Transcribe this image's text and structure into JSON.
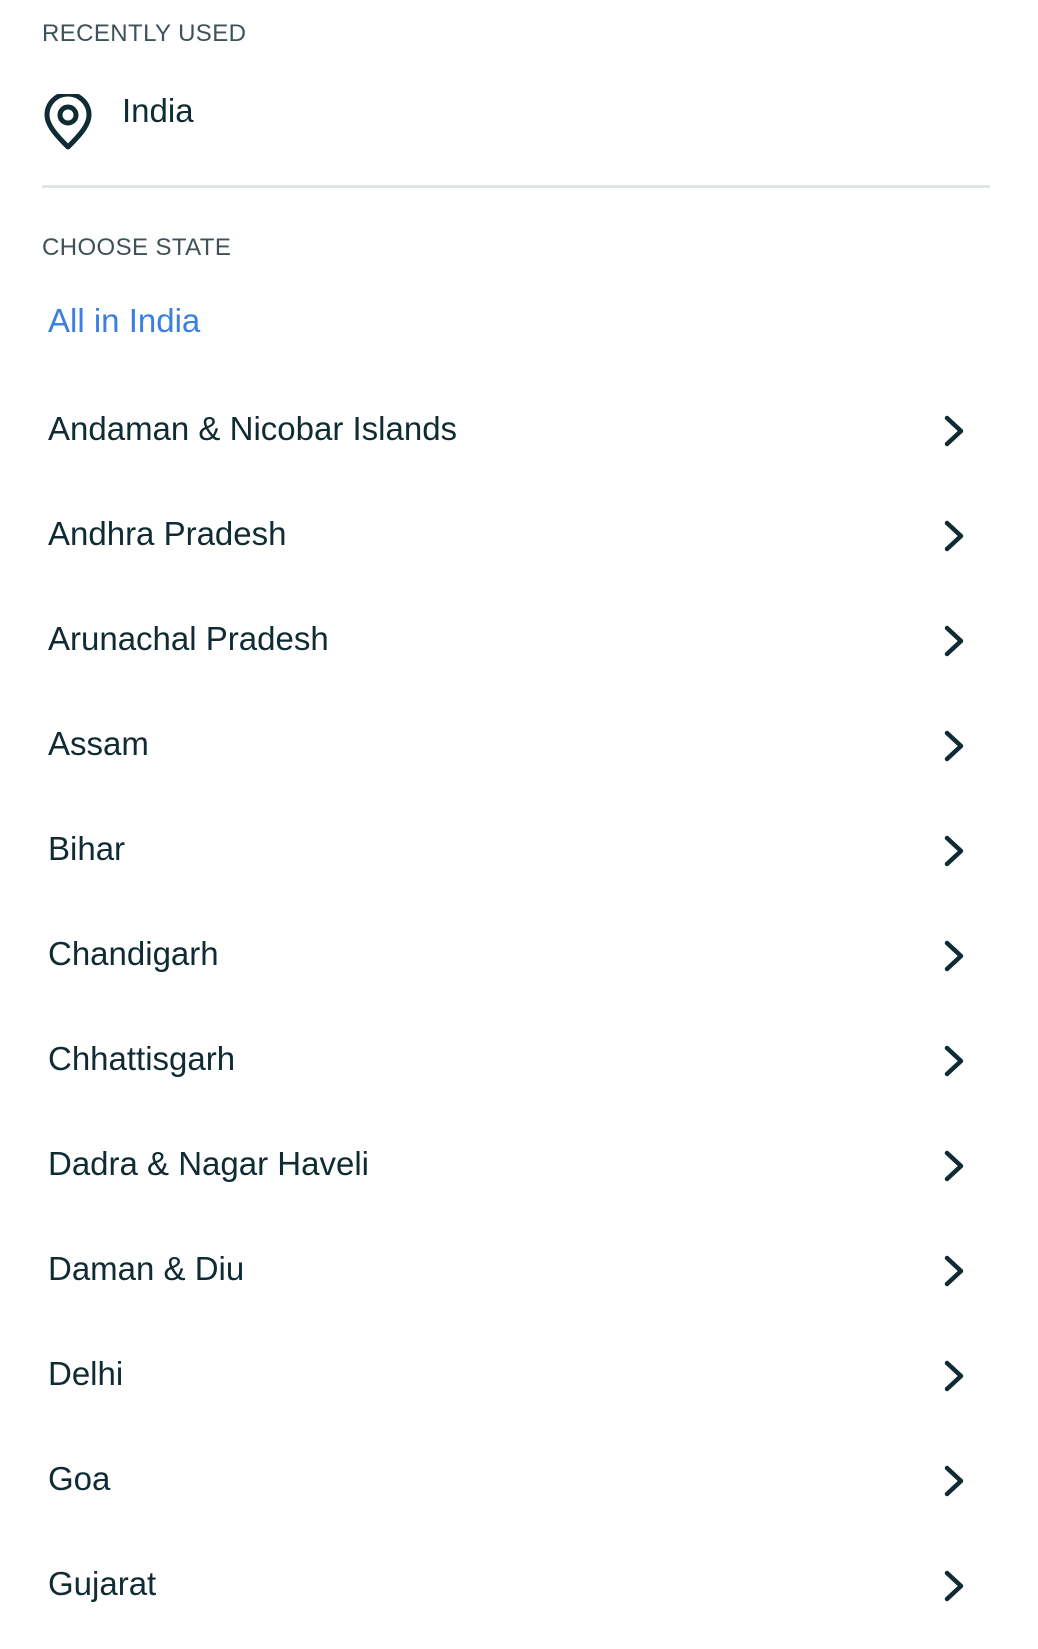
{
  "recent": {
    "section_label": "RECENTLY USED",
    "item": {
      "label": "India",
      "icon": "location-pin-icon"
    }
  },
  "choose": {
    "section_label": "CHOOSE STATE",
    "all_label": "All in India",
    "all_color": "#3b7fe0",
    "states": [
      {
        "label": "Andaman & Nicobar Islands"
      },
      {
        "label": "Andhra Pradesh"
      },
      {
        "label": "Arunachal Pradesh"
      },
      {
        "label": "Assam"
      },
      {
        "label": "Bihar"
      },
      {
        "label": "Chandigarh"
      },
      {
        "label": "Chhattisgarh"
      },
      {
        "label": "Dadra & Nagar Haveli"
      },
      {
        "label": "Daman & Diu"
      },
      {
        "label": "Delhi"
      },
      {
        "label": "Goa"
      },
      {
        "label": "Gujarat"
      }
    ],
    "row_icon": "chevron-right-icon"
  },
  "colors": {
    "text": "#0f2b33",
    "label": "#3e5257",
    "divider": "#dfe6e8"
  }
}
